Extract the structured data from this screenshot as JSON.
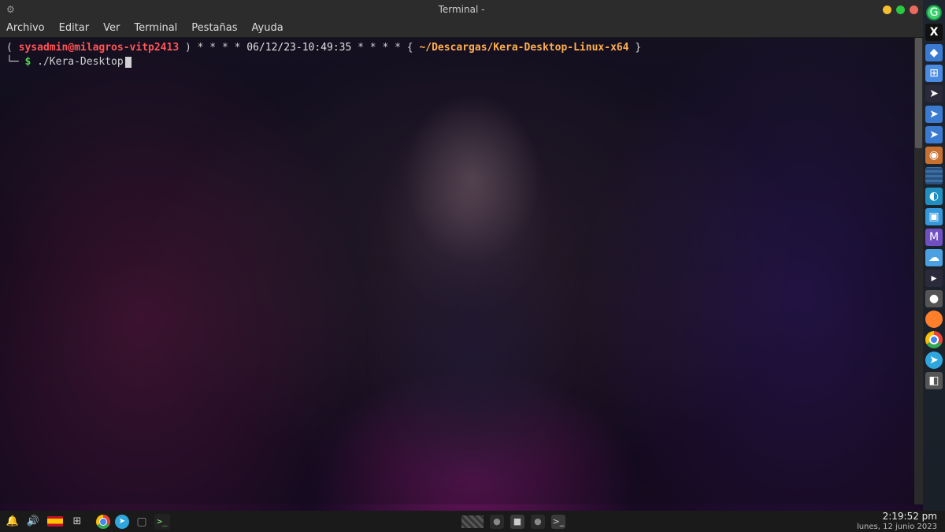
{
  "window": {
    "title": "Terminal -",
    "menus": [
      "Archivo",
      "Editar",
      "Ver",
      "Terminal",
      "Pestañas",
      "Ayuda"
    ]
  },
  "prompt": {
    "open_bracket": "( ",
    "user_host": "sysadmin@milagros-vitp2413",
    "close_bracket": " )",
    "stars_left": " * * * * ",
    "datetime": "06/12/23-10:49:35",
    "stars_right": " * * * * ",
    "brace_open": "{ ",
    "path": "~/Descargas/Kera-Desktop-Linux-x64",
    "brace_close": " }",
    "corner": "└─",
    "dollar": " $ ",
    "command": "./Kera-Desktop"
  },
  "side_dock": {
    "items": [
      {
        "name": "grammarly-icon",
        "cls": "green-circle",
        "glyph": "G"
      },
      {
        "name": "x11-icon",
        "cls": "x-box",
        "glyph": "X"
      },
      {
        "name": "kde-icon",
        "cls": "blue",
        "glyph": "◆"
      },
      {
        "name": "display-settings-icon",
        "cls": "blue2",
        "glyph": "⊞"
      },
      {
        "name": "cursor-theme-icon",
        "cls": "dark",
        "glyph": "➤"
      },
      {
        "name": "cursor-icon",
        "cls": "blue",
        "glyph": "➤"
      },
      {
        "name": "cursor-alt-icon",
        "cls": "blue",
        "glyph": "➤"
      },
      {
        "name": "app-icon-1",
        "cls": "orange",
        "glyph": "◉"
      },
      {
        "name": "app-icon-2",
        "cls": "striped",
        "glyph": ""
      },
      {
        "name": "app-icon-3",
        "cls": "cyan",
        "glyph": "◐"
      },
      {
        "name": "dolphin-icon",
        "cls": "kde",
        "glyph": "▣"
      },
      {
        "name": "app-icon-4",
        "cls": "purple",
        "glyph": "M"
      },
      {
        "name": "cloud-icon",
        "cls": "cloud",
        "glyph": "☁"
      },
      {
        "name": "app-icon-5",
        "cls": "dark",
        "glyph": "▸"
      },
      {
        "name": "app-icon-6",
        "cls": "gray",
        "glyph": "●"
      },
      {
        "name": "firefox-icon",
        "cls": "fox",
        "glyph": ""
      },
      {
        "name": "chrome-icon",
        "cls": "chrome",
        "glyph": ""
      },
      {
        "name": "telegram-icon",
        "cls": "telegram",
        "glyph": "➤"
      },
      {
        "name": "app-icon-7",
        "cls": "gray",
        "glyph": "◧"
      }
    ]
  },
  "taskbar": {
    "left_icons": [
      {
        "name": "notifications-icon",
        "glyph": "🔔"
      },
      {
        "name": "volume-icon",
        "glyph": "🔊"
      }
    ],
    "tasks": [
      {
        "name": "task-chrome",
        "cls": "chrome",
        "glyph": ""
      },
      {
        "name": "task-telegram",
        "cls": "telegram",
        "glyph": "➤"
      },
      {
        "name": "task-window",
        "cls": "window",
        "glyph": "▢"
      },
      {
        "name": "task-terminal",
        "cls": "term",
        "glyph": ">_"
      }
    ],
    "center": [
      {
        "name": "workspace-1",
        "glyph": "●",
        "active": false
      },
      {
        "name": "workspace-2",
        "glyph": "■",
        "active": true
      },
      {
        "name": "workspace-3",
        "glyph": "●",
        "active": false
      },
      {
        "name": "workspace-4",
        "glyph": ">_",
        "active": true
      }
    ],
    "time": "2:19:52 pm",
    "date": "lunes, 12 junio 2023"
  }
}
